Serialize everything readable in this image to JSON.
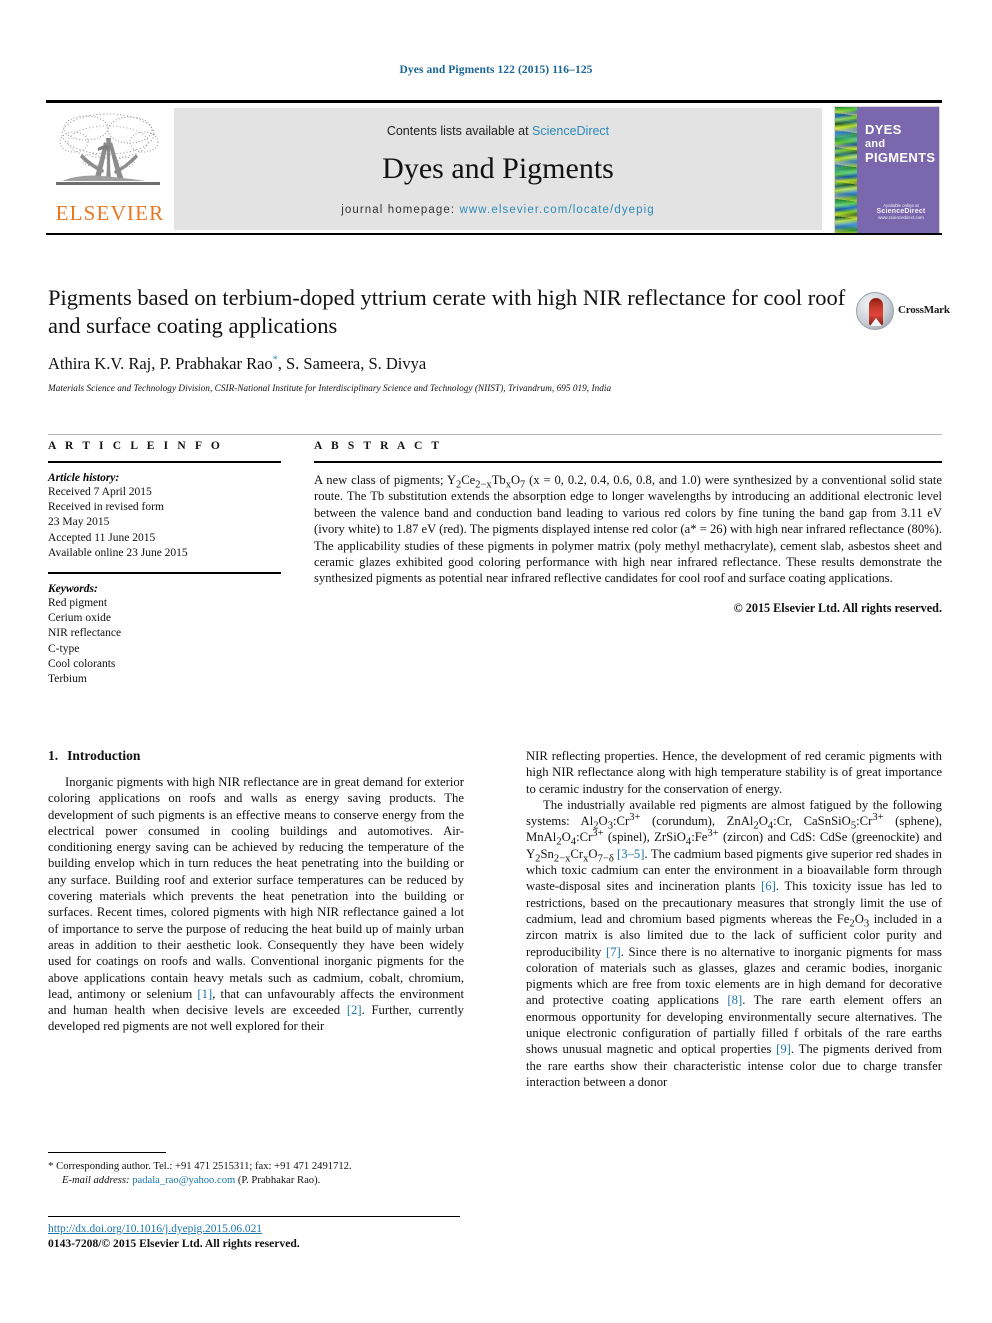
{
  "running_head": "Dyes and Pigments 122 (2015) 116–125",
  "masthead": {
    "contents_prefix": "Contents lists available at",
    "sciencedirect": "ScienceDirect",
    "journal_name": "Dyes and Pigments",
    "homepage_prefix": "journal homepage:",
    "homepage_url": "www.elsevier.com/locate/dyepig",
    "publisher_wordmark": "ELSEVIER",
    "cover": {
      "line1": "DYES",
      "line2": "and",
      "line3": "PIGMENTS",
      "footer_note": "Available online at",
      "footer_mark": "ScienceDirect",
      "footer_sub": "www.sciencedirect.com"
    }
  },
  "article": {
    "title": "Pigments based on terbium-doped yttrium cerate with high NIR reflectance for cool roof and surface coating applications",
    "authors": "Athira K.V. Raj, P. Prabhakar Rao",
    "authors_tail": ", S. Sameera, S. Divya",
    "corresponding_marker": "*",
    "affiliation": "Materials Science and Technology Division, CSIR-National Institute for Interdisciplinary Science and Technology (NIIST), Trivandrum, 695 019, India",
    "crossmark_label": "CrossMark"
  },
  "article_info": {
    "heading": "A R T I C L E   I N F O",
    "history_label": "Article history:",
    "history": [
      "Received 7 April 2015",
      "Received in revised form",
      "23 May 2015",
      "Accepted 11 June 2015",
      "Available online 23 June 2015"
    ],
    "keywords_label": "Keywords:",
    "keywords": [
      "Red pigment",
      "Cerium oxide",
      "NIR reflectance",
      "C-type",
      "Cool colorants",
      "Terbium"
    ]
  },
  "abstract": {
    "heading": "A B S T R A C T",
    "part1": "A new class of pigments; Y",
    "formula_sub1": "2",
    "formula_mid": "Ce",
    "formula_sub2": "2−x",
    "formula_mid2": "Tb",
    "formula_sub3": "x",
    "formula_mid3": "O",
    "formula_sub4": "7",
    "part2": " (x = 0, 0.2, 0.4, 0.6, 0.8, and 1.0) were synthesized by a conventional solid state route. The Tb substitution extends the absorption edge to longer wavelengths by introducing an additional electronic level between the valence band and conduction band leading to various red colors by fine tuning the band gap from 3.11 eV (ivory white) to 1.87 eV (red). The pigments displayed intense red color (a* = 26) with high near infrared reflectance (80%). The applicability studies of these pigments in polymer matrix (poly methyl methacrylate), cement slab, asbestos sheet and ceramic glazes exhibited good coloring performance with high near infrared reflectance. These results demonstrate the synthesized pigments as potential near infrared reflective candidates for cool roof and surface coating applications.",
    "copyright": "© 2015 Elsevier Ltd. All rights reserved."
  },
  "introduction": {
    "number": "1.",
    "title": "Introduction",
    "left_p1_a": "Inorganic pigments with high NIR reflectance are in great demand for exterior coloring applications on roofs and walls as energy saving products. The development of such pigments is an effective means to conserve energy from the electrical power consumed in cooling buildings and automotives. Air-conditioning energy saving can be achieved by reducing the temperature of the building envelop which in turn reduces the heat penetrating into the building or any surface. Building roof and exterior surface temperatures can be reduced by covering materials which prevents the heat penetration into the building or surfaces. Recent times, colored pigments with high NIR reflectance gained a lot of importance to serve the purpose of reducing the heat build up of mainly urban areas in addition to their aesthetic look. Consequently they have been widely used for coatings on roofs and walls. Conventional inorganic pigments for the above applications contain heavy metals such as cadmium, cobalt, chromium, lead, antimony or selenium ",
    "ref1": "[1]",
    "left_p1_b": ", that can unfavourably affects the environment and human health when decisive levels are exceeded ",
    "ref2": "[2]",
    "left_p1_c": ". Further, currently developed red pigments are not well explored for their",
    "right_p1": "NIR reflecting properties. Hence, the development of red ceramic pigments with high NIR reflectance along with high temperature stability is of great importance to ceramic industry for the conservation of energy.",
    "right_p2_a": "The industrially available red pigments are almost fatigued by the following systems: Al",
    "right_p2_b": " (corundum), ZnAl",
    "right_p2_c": ":Cr, CaSnSiO",
    "right_p2_d": " (sphene), MnAl",
    "right_p2_e": " (spinel), ZrSiO",
    "right_p2_f": " (zircon) and CdS: CdSe (greenockite) and Y",
    "ref35": "[3–5]",
    "right_p2_g": ". The cadmium based pigments give superior red shades in which toxic cadmium can enter the environment in a bioavailable form through waste-disposal sites and incineration plants ",
    "ref6": "[6]",
    "right_p2_h": ". This toxicity issue has led to restrictions, based on the precautionary measures that strongly limit the use of cadmium, lead and chromium based pigments whereas the Fe",
    "right_p2_i": " included in a zircon matrix is also limited due to the lack of sufficient color purity and reproducibility ",
    "ref7": "[7]",
    "right_p2_j": ". Since there is no alternative to inorganic pigments for mass coloration of materials such as glasses, glazes and ceramic bodies, inorganic pigments which are free from toxic elements are in high demand for decorative and protective coating applications ",
    "ref8": "[8]",
    "right_p2_k": ". The rare earth element offers an enormous opportunity for developing environmentally secure alternatives. The unique electronic configuration of partially filled f orbitals of the rare earths shows unusual magnetic and optical properties ",
    "ref9": "[9]",
    "right_p2_l": ". The pigments derived from the rare earths show their characteristic intense color due to charge transfer interaction between a donor"
  },
  "footnote": {
    "marker": "*",
    "text": "Corresponding author. Tel.: +91 471 2515311; fax: +91 471 2491712.",
    "email_label": "E-mail address:",
    "email": "padala_rao@yahoo.com",
    "email_owner": "(P. Prabhakar Rao)."
  },
  "footer": {
    "doi": "http://dx.doi.org/10.1016/j.dyepig.2015.06.021",
    "issn": "0143-7208/© 2015 Elsevier Ltd. All rights reserved."
  },
  "colors": {
    "link": "#1a74a8",
    "sciencedirect": "#2e8ab8",
    "elsevier_orange": "#e87722",
    "cover_purple": "#7a67ad"
  }
}
